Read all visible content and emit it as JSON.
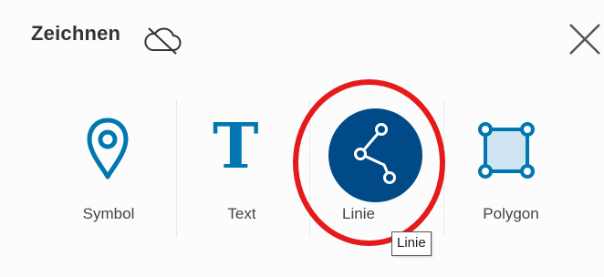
{
  "header": {
    "title": "Zeichnen",
    "status_icon": "cloud-off-icon",
    "close_icon": "close-icon"
  },
  "tools": [
    {
      "label": "Symbol",
      "icon": "map-pin-icon",
      "selected": false
    },
    {
      "label": "Text",
      "icon": "text-icon",
      "glyph": "T",
      "selected": false
    },
    {
      "label": "Linie",
      "icon": "line-icon",
      "selected": true
    },
    {
      "label": "Polygon",
      "icon": "polygon-icon",
      "selected": false
    }
  ],
  "tooltip": {
    "text": "Linie"
  },
  "colors": {
    "accent": "#0077b0",
    "selected_bg": "#004b87",
    "highlight_ring": "#e51a1a",
    "polygon_fill": "#cfe4f2"
  }
}
